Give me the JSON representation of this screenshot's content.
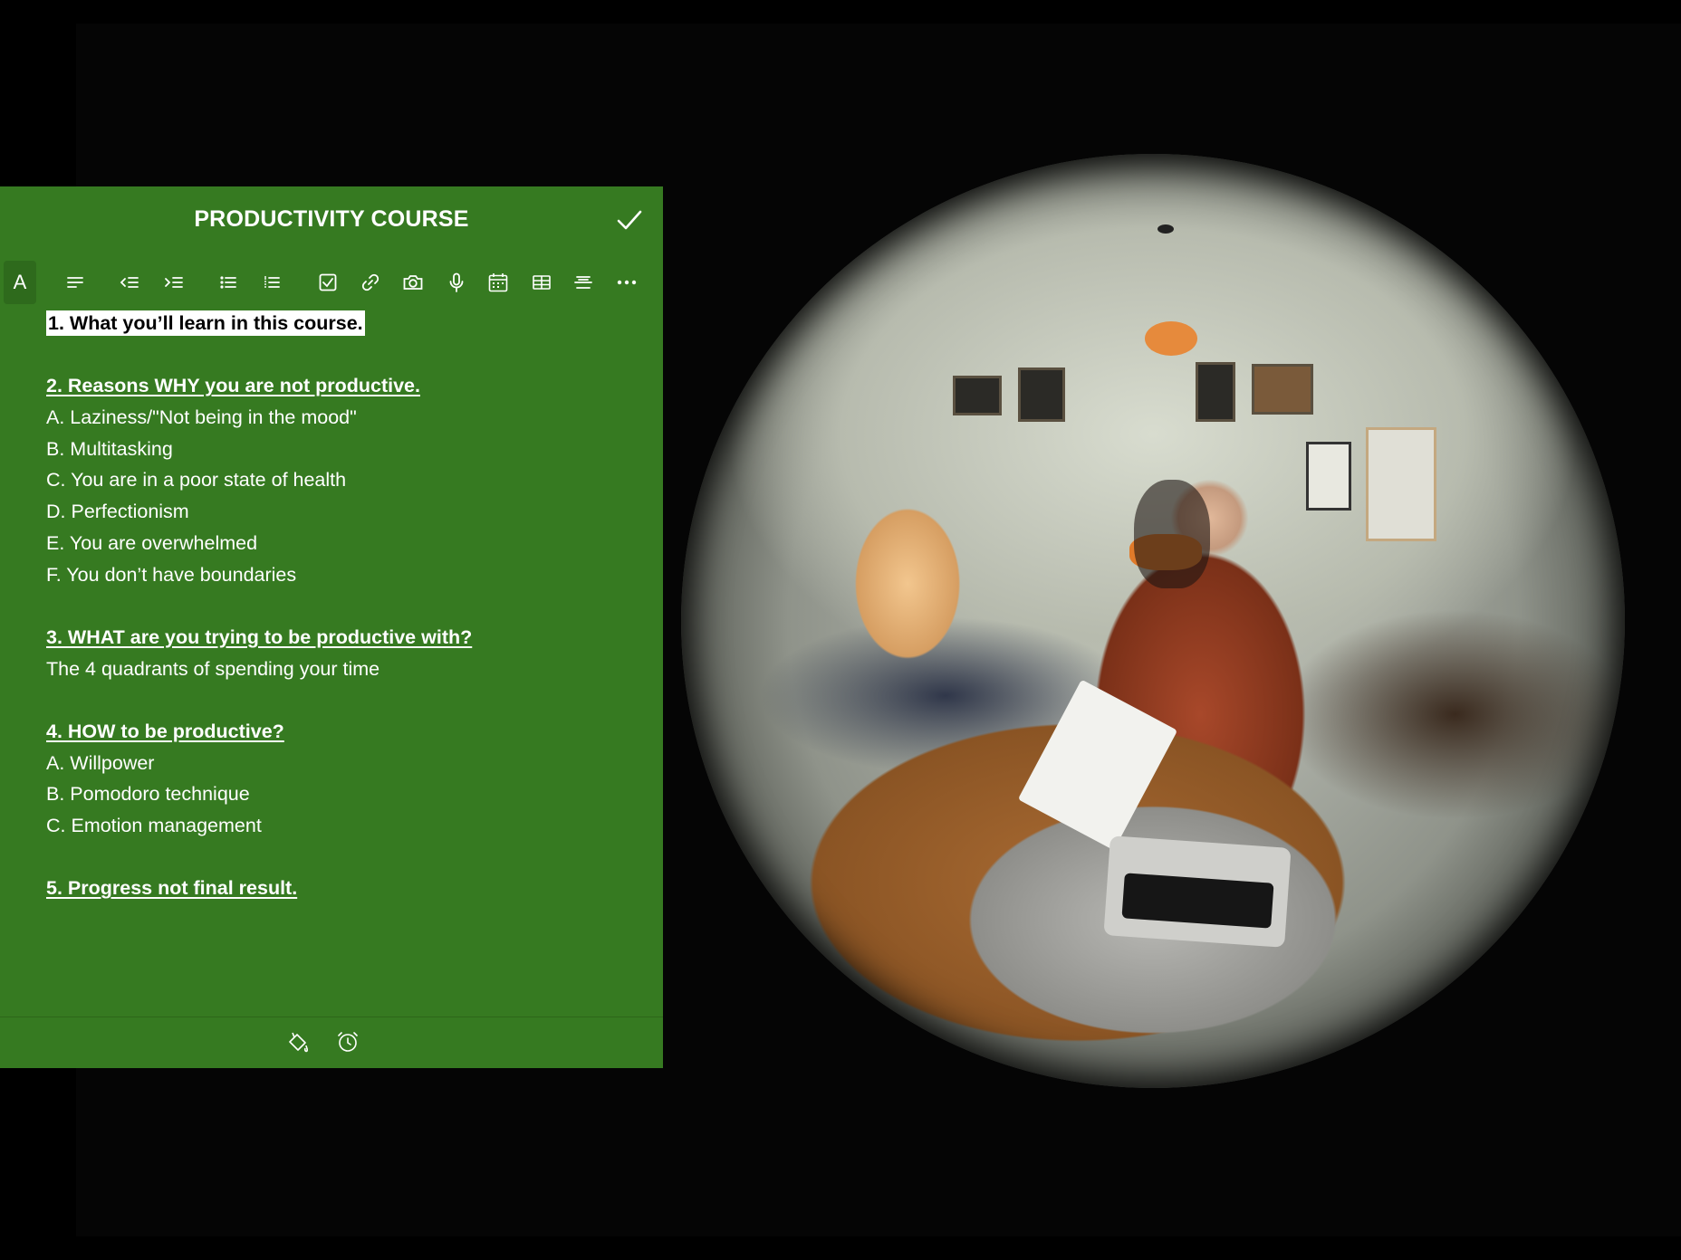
{
  "note": {
    "title": "PRODUCTIVITY COURSE",
    "toolbar": {
      "items": [
        {
          "name": "font-style-button",
          "icon": "text-style-icon",
          "glyph": "A"
        },
        {
          "name": "align-button",
          "icon": "align-left-icon"
        },
        {
          "name": "outdent-button",
          "icon": "outdent-icon"
        },
        {
          "name": "indent-button",
          "icon": "indent-icon"
        },
        {
          "name": "bullet-list-button",
          "icon": "bullet-list-icon"
        },
        {
          "name": "numbered-list-button",
          "icon": "numbered-list-icon"
        },
        {
          "name": "checklist-button",
          "icon": "checkbox-icon"
        },
        {
          "name": "link-button",
          "icon": "link-icon"
        },
        {
          "name": "camera-button",
          "icon": "camera-icon"
        },
        {
          "name": "microphone-button",
          "icon": "microphone-icon"
        },
        {
          "name": "calendar-button",
          "icon": "calendar-icon"
        },
        {
          "name": "table-button",
          "icon": "table-icon"
        },
        {
          "name": "strikethrough-button",
          "icon": "strikethrough-icon"
        },
        {
          "name": "more-button",
          "icon": "more-icon"
        }
      ]
    },
    "content": {
      "s1": "1. What you’ll learn in this course.",
      "s2": "2. Reasons WHY you are not productive.",
      "s2_items": [
        "A. Laziness/\"Not being in the mood\"",
        "B. Multitasking",
        "C. You are in a poor state of health",
        "D. Perfectionism",
        "E. You are overwhelmed",
        "F. You don’t have boundaries"
      ],
      "s3": "3. WHAT are you trying to be productive with?",
      "s3_body": "The 4 quadrants of spending your time",
      "s4": "4. HOW to be productive?",
      "s4_items": [
        "A. Willpower",
        "B. Pomodoro technique",
        "C. Emotion management"
      ],
      "s5": "5. Progress not final result."
    },
    "footer": {
      "icons": [
        "paint-bucket-icon",
        "alarm-clock-icon"
      ]
    },
    "colors": {
      "panel_bg": "#367a21",
      "text": "#ffffff",
      "selection_bg": "#ffffff"
    }
  },
  "video": {
    "icon": "fisheye-video-frame"
  }
}
